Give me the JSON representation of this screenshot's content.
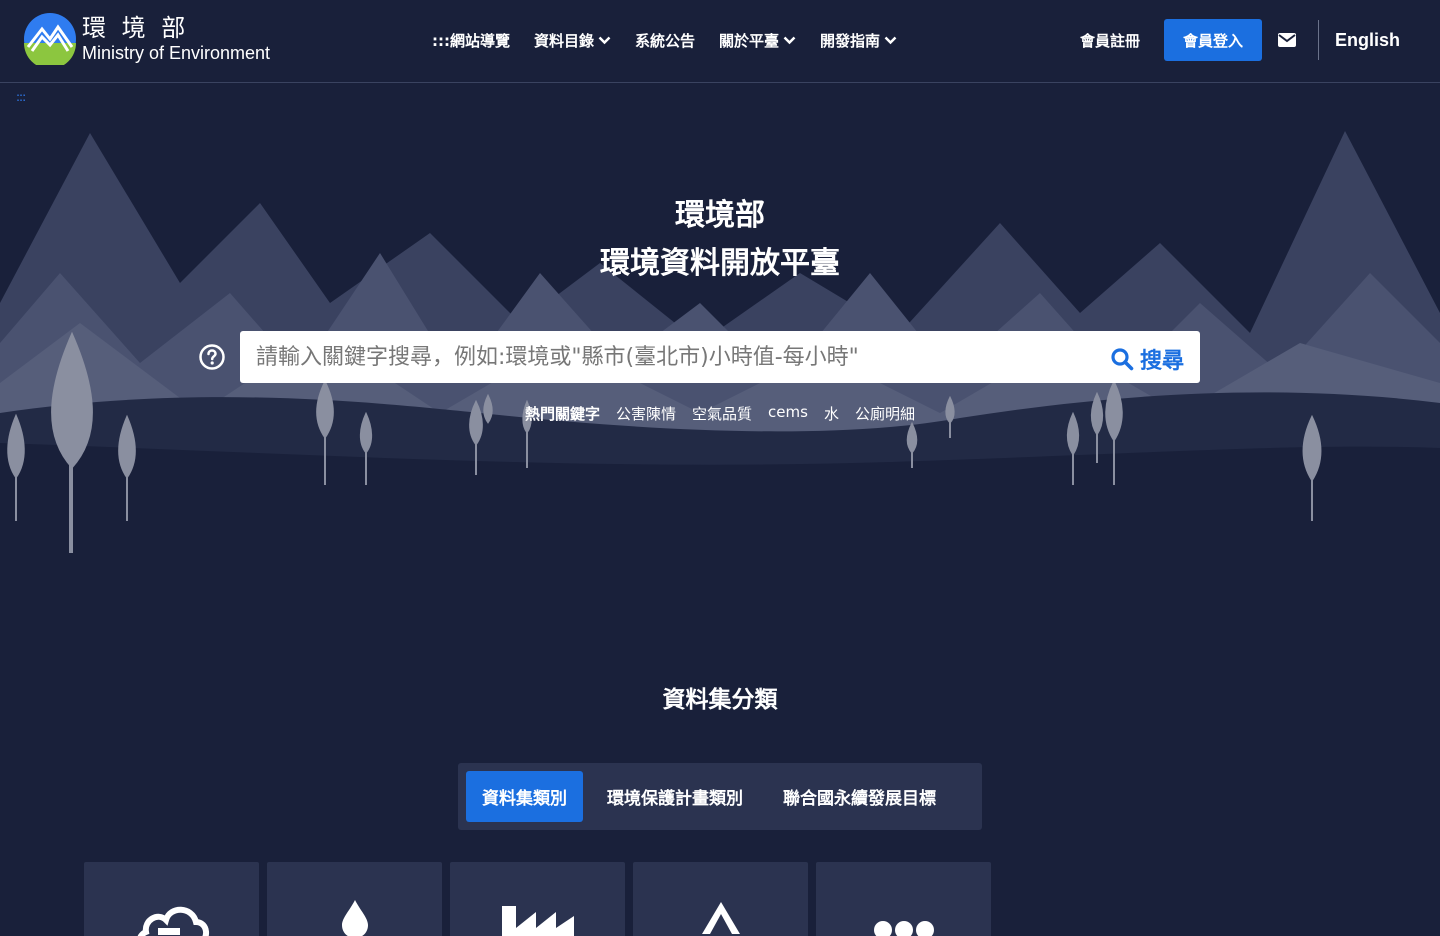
{
  "header": {
    "logo_zh": "環 境 部",
    "logo_en": "Ministry of Environment",
    "nav": [
      {
        "label": ":::網站導覽",
        "dropdown": false
      },
      {
        "label": "資料目錄",
        "dropdown": true
      },
      {
        "label": "系統公告",
        "dropdown": false
      },
      {
        "label": "關於平臺",
        "dropdown": true
      },
      {
        "label": "開發指南",
        "dropdown": true
      }
    ],
    "register": "會員註冊",
    "login": "會員登入",
    "mail_icon": "envelope-icon",
    "language": "English",
    "skip_link": ":::"
  },
  "hero": {
    "title_line1": "環境部",
    "title_line2": "環境資料開放平臺",
    "search_placeholder": "請輸入關鍵字搜尋，例如:環境或\"縣市(臺北市)小時值-每小時\"",
    "search_button": "搜尋",
    "hot_label": "熱門關鍵字",
    "hot_keywords": [
      "公害陳情",
      "空氣品質",
      "cems",
      "水",
      "公廁明細"
    ]
  },
  "categories": {
    "title": "資料集分類",
    "tabs": [
      {
        "label": "資料集類別",
        "active": true
      },
      {
        "label": "環境保護計畫類別",
        "active": false
      },
      {
        "label": "聯合國永續發展目標",
        "active": false
      }
    ],
    "cards": [
      {
        "icon": "cloud-icon"
      },
      {
        "icon": "water-drop-icon"
      },
      {
        "icon": "factory-icon"
      },
      {
        "icon": "recycle-icon"
      },
      {
        "icon": "more-icon"
      }
    ]
  },
  "colors": {
    "background": "#19203a",
    "accent": "#1b6fe0",
    "panel": "#2b3350"
  }
}
